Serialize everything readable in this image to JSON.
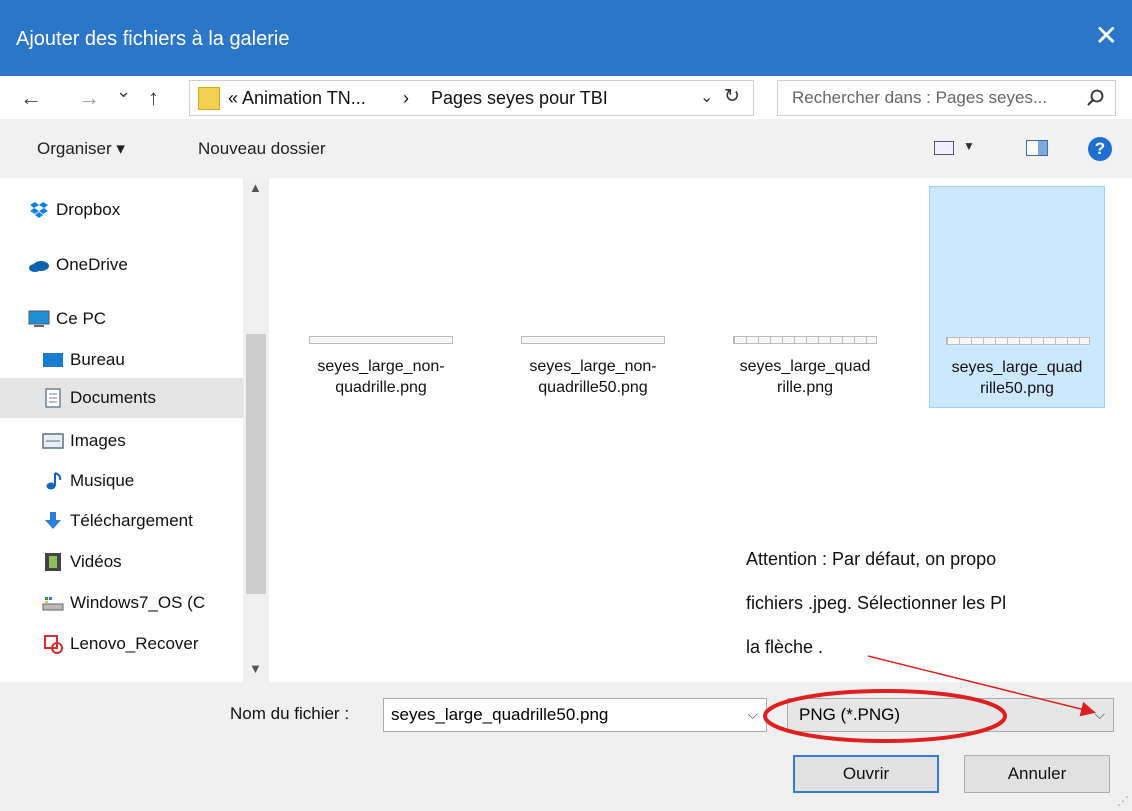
{
  "window": {
    "title": "Ajouter des fichiers à la galerie",
    "close_glyph": "✕"
  },
  "nav": {
    "back_glyph": "←",
    "forward_glyph": "→",
    "recent_glyph": "⌄",
    "up_glyph": "↑",
    "breadcrumb": [
      "« Animation TN...",
      "›",
      "Pages seyes pour TBI"
    ],
    "address_dropdown_glyph": "⌄",
    "refresh_glyph": "↻",
    "search_placeholder": "Rechercher dans : Pages seyes...",
    "search_icon": "search-icon"
  },
  "toolbar": {
    "organise_label": "Organiser ▾",
    "new_folder_label": "Nouveau dossier",
    "help_label": "?"
  },
  "sidebar": {
    "items": [
      {
        "label": "Dropbox",
        "icon": "dropbox-icon",
        "color": "#1081de"
      },
      {
        "label": "OneDrive",
        "icon": "onedrive-icon",
        "color": "#0a64ad"
      },
      {
        "label": "Ce PC",
        "icon": "computer-icon",
        "color": "#1e90d6"
      },
      {
        "label": "Bureau",
        "icon": "desktop-icon",
        "color": "#1a7bd2"
      },
      {
        "label": "Documents",
        "icon": "documents-icon",
        "color": "#6f8296"
      },
      {
        "label": "Images",
        "icon": "images-icon",
        "color": "#5c6f84"
      },
      {
        "label": "Musique",
        "icon": "music-icon",
        "color": "#1565c0"
      },
      {
        "label": "Téléchargement",
        "icon": "download-icon",
        "color": "#2a80d6"
      },
      {
        "label": "Vidéos",
        "icon": "videos-icon",
        "color": "#444"
      },
      {
        "label": "Windows7_OS (C",
        "icon": "drive-icon",
        "color": "#2aa04a"
      },
      {
        "label": "Lenovo_Recover",
        "icon": "recovery-drive-icon",
        "color": "#d62c2c"
      }
    ],
    "selected": "Documents"
  },
  "files": [
    {
      "name_line1": "seyes_large_non-",
      "name_line2": "quadrille.png"
    },
    {
      "name_line1": "seyes_large_non-",
      "name_line2": "quadrille50.png"
    },
    {
      "name_line1": "seyes_large_quad",
      "name_line2": "rille.png"
    },
    {
      "name_line1": "seyes_large_quad",
      "name_line2": "rille50.png"
    }
  ],
  "annotation": {
    "line1": "Attention : Par défaut, on  propo",
    "line2": "fichiers .jpeg. Sélectionner les Pl",
    "line3": "la flèche ."
  },
  "footer": {
    "filename_label": "Nom du fichier :",
    "filename_value": "seyes_large_quadrille50.png",
    "filetype_value": "PNG (*.PNG)",
    "open_label": "Ouvrir",
    "cancel_label": "Annuler"
  },
  "colors": {
    "title_bar": "#2b76c8",
    "selection": "#cce8ff",
    "annotation_red": "#e02020"
  }
}
